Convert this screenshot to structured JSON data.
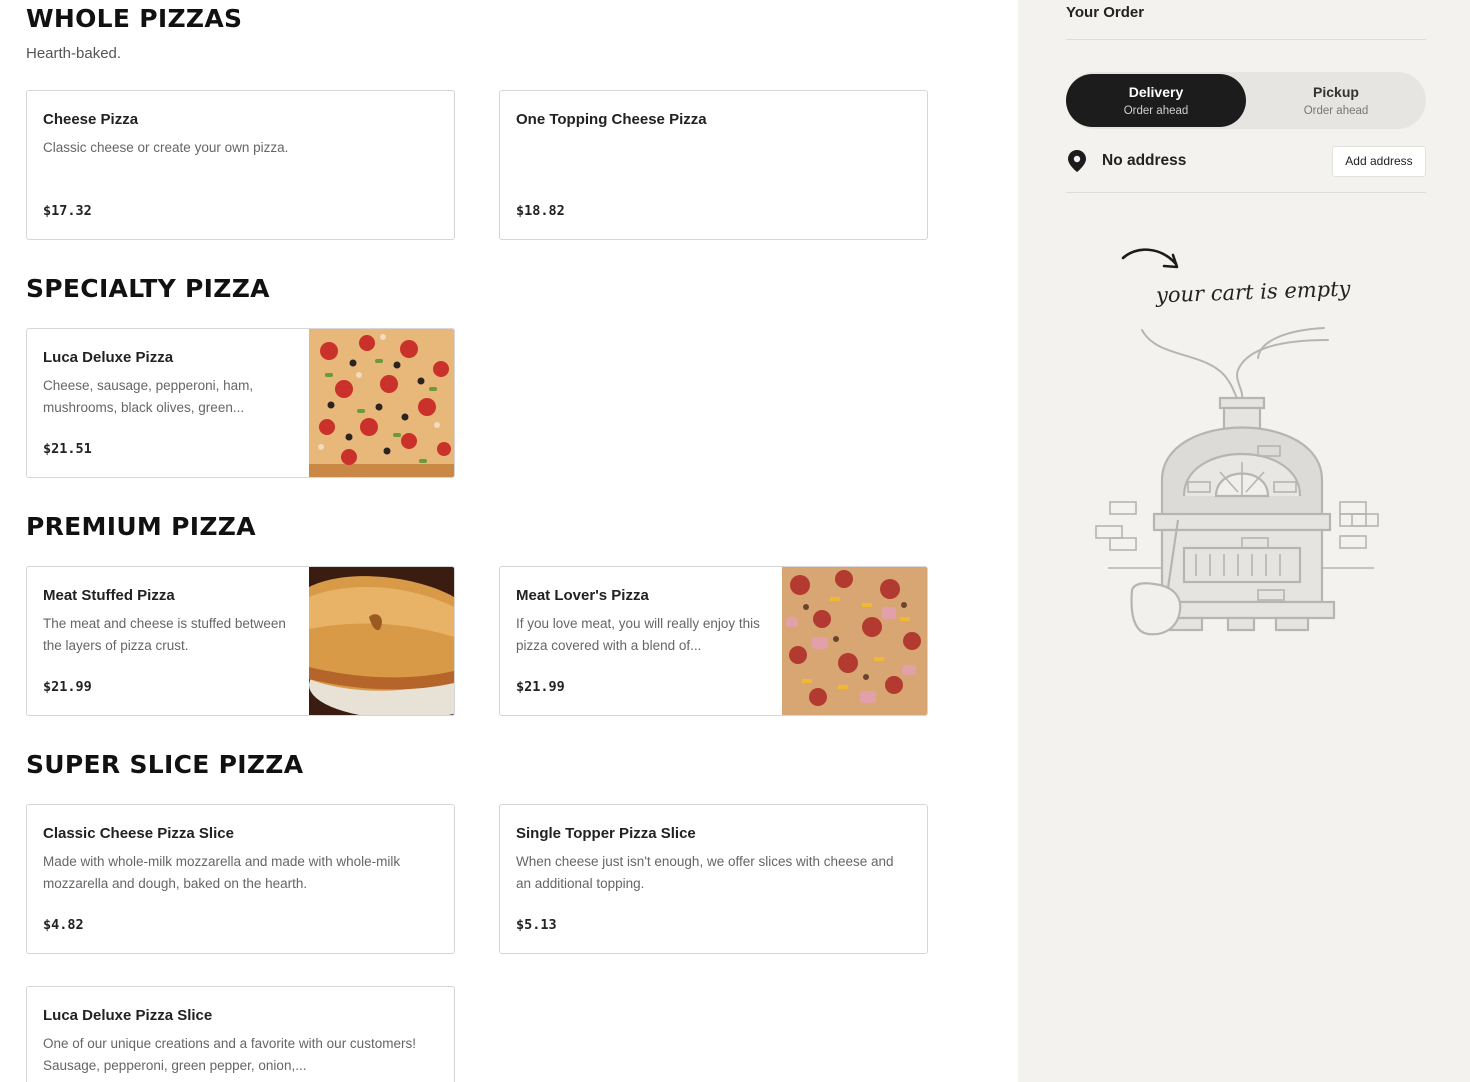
{
  "menu": {
    "sections": [
      {
        "title": "WHOLE PIZZAS",
        "subtitle": "Hearth-baked.",
        "items": [
          {
            "name": "Cheese Pizza",
            "description": "Classic cheese or create your own pizza.",
            "price": "$17.32"
          },
          {
            "name": "One Topping Cheese Pizza",
            "description": "",
            "price": "$18.82"
          }
        ]
      },
      {
        "title": "SPECIALTY PIZZA",
        "items": [
          {
            "name": "Luca Deluxe Pizza",
            "description": "Cheese, sausage, pepperoni, ham, mushrooms, black olives, green...",
            "price": "$21.51",
            "image": "luca-deluxe-pizza-photo"
          }
        ]
      },
      {
        "title": "PREMIUM PIZZA",
        "items": [
          {
            "name": "Meat Stuffed Pizza",
            "description": "The meat and cheese is stuffed between the layers of pizza crust.",
            "price": "$21.99",
            "image": "meat-stuffed-pizza-photo"
          },
          {
            "name": "Meat Lover's Pizza",
            "description": "If you love meat, you will really enjoy this pizza covered with a blend of...",
            "price": "$21.99",
            "image": "meat-lovers-pizza-photo"
          }
        ]
      },
      {
        "title": "SUPER SLICE PIZZA",
        "items": [
          {
            "name": "Classic Cheese Pizza Slice",
            "description": "Made with whole-milk mozzarella and made with whole-milk mozzarella and dough, baked on the hearth.",
            "price": "$4.82"
          },
          {
            "name": "Single Topper Pizza Slice",
            "description": "When cheese just isn't enough, we offer slices with cheese and an additional topping.",
            "price": "$5.13"
          },
          {
            "name": "Luca Deluxe Pizza Slice",
            "description": "One of our unique creations and a favorite with our customers! Sausage, pepperoni, green pepper, onion,...",
            "price": ""
          }
        ]
      }
    ]
  },
  "order": {
    "title": "Your Order",
    "delivery_label": "Delivery",
    "delivery_sub": "Order ahead",
    "pickup_label": "Pickup",
    "pickup_sub": "Order ahead",
    "selected_mode": "Delivery",
    "address_text": "No address",
    "add_address_label": "Add address",
    "empty_cart_text": "your cart is empty",
    "icons": [
      "location-pin-icon",
      "arrow-icon",
      "pizza-oven-illustration"
    ]
  },
  "colors": {
    "accent_dark": "#1c1c1c",
    "sidebar_bg": "#f3f2ef",
    "card_border": "#d6d6d6"
  }
}
